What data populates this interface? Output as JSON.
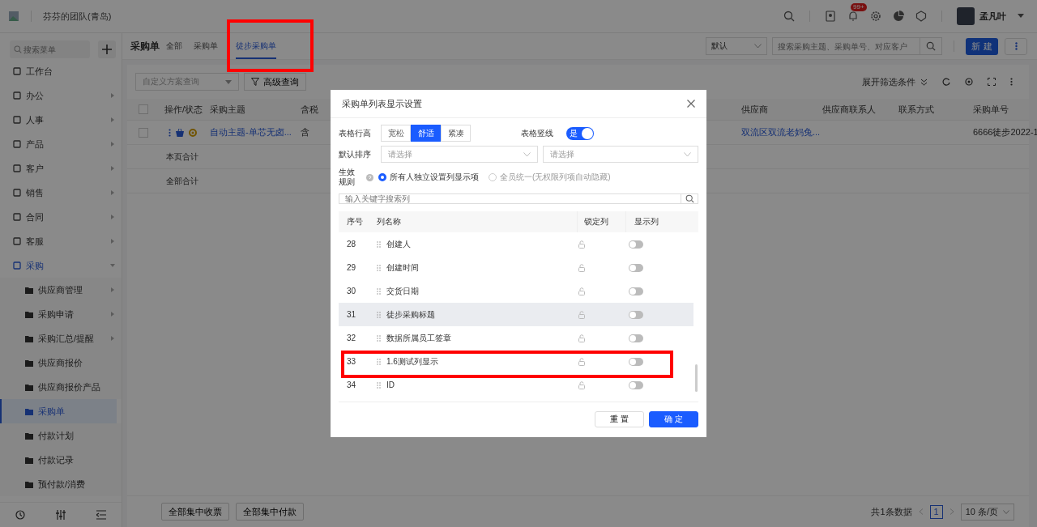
{
  "topbar": {
    "team": "芬芬的团队(青岛)",
    "badge": "99+",
    "user": "孟凡叶"
  },
  "sidebar": {
    "search_placeholder": "搜索菜单",
    "items": [
      {
        "label": "工作台",
        "expandable": false,
        "selected": false
      },
      {
        "label": "办公",
        "expandable": true,
        "expanded": false,
        "selected": false
      },
      {
        "label": "人事",
        "expandable": true,
        "expanded": false,
        "selected": false
      },
      {
        "label": "产品",
        "expandable": true,
        "expanded": false,
        "selected": false
      },
      {
        "label": "客户",
        "expandable": true,
        "expanded": false,
        "selected": false
      },
      {
        "label": "销售",
        "expandable": true,
        "expanded": false,
        "selected": false
      },
      {
        "label": "合同",
        "expandable": true,
        "expanded": false,
        "selected": false
      },
      {
        "label": "客服",
        "expandable": true,
        "expanded": false,
        "selected": false
      },
      {
        "label": "采购",
        "expandable": true,
        "expanded": true,
        "selected": true,
        "children": [
          {
            "label": "供应商管理",
            "expandable": true,
            "selected": false
          },
          {
            "label": "采购申请",
            "expandable": true,
            "selected": false
          },
          {
            "label": "采购汇总/提醒",
            "expandable": true,
            "selected": false
          },
          {
            "label": "供应商报价",
            "expandable": false,
            "selected": false
          },
          {
            "label": "供应商报价产品",
            "expandable": false,
            "selected": false
          },
          {
            "label": "采购单",
            "expandable": false,
            "selected": true
          },
          {
            "label": "付款计划",
            "expandable": false,
            "selected": false
          },
          {
            "label": "付款记录",
            "expandable": false,
            "selected": false
          },
          {
            "label": "预付款/消费",
            "expandable": false,
            "selected": false
          }
        ]
      }
    ]
  },
  "header": {
    "title": "采购单",
    "tabs": [
      {
        "label": "全部",
        "selected": false
      },
      {
        "label": "采购单",
        "selected": false
      },
      {
        "label": "徒步采购单",
        "selected": true
      }
    ],
    "filter": "默认",
    "search_placeholder": "搜索采购主题、采购单号、对应客户",
    "new_button": "新 建"
  },
  "toolbar": {
    "scheme_placeholder": "自定义方案查询",
    "advanced_button": "高级查询",
    "expand_filters": "展开筛选条件"
  },
  "table": {
    "all_checked": false,
    "columns": [
      "操作/状态",
      "采购主题",
      "含税",
      "",
      "供应商",
      "供应商联系人",
      "联系方式",
      "采购单号"
    ],
    "rows": [
      {
        "checked": false,
        "subject": "自动主题-单芯无卤...",
        "tax": "含",
        "supplier": "双流区双流老妈兔...",
        "number": "6666徒步2022-1"
      }
    ],
    "summary": [
      "本页合计",
      "全部合计"
    ]
  },
  "footer": {
    "buttons": [
      "全部集中收票",
      "全部集中付款"
    ],
    "total": "共1条数据",
    "page": "1",
    "page_size": "10 条/页"
  },
  "dialog": {
    "title": "采购单列表显示设置",
    "row_height_label": "表格行高",
    "row_heights": [
      {
        "label": "宽松",
        "selected": false
      },
      {
        "label": "舒适",
        "selected": true
      },
      {
        "label": "紧凑",
        "selected": false
      }
    ],
    "grid_label": "表格竖线",
    "grid_on": true,
    "grid_on_text": "是",
    "sort_label": "默认排序",
    "sort_placeholders": [
      "请选择",
      "请选择"
    ],
    "rule_label": "生效规则",
    "rules": [
      {
        "label": "所有人独立设置列显示项",
        "selected": true,
        "disabled": false
      },
      {
        "label": "全员统一(无权限列项自动隐藏)",
        "selected": false,
        "disabled": true
      }
    ],
    "search_placeholder": "输入关键字搜索列",
    "columns": [
      "序号",
      "列名称",
      "锁定列",
      "显示列"
    ],
    "rows": [
      {
        "no": "28",
        "name": "创建人",
        "locked": false,
        "shown": false,
        "hovered": false
      },
      {
        "no": "29",
        "name": "创建时间",
        "locked": false,
        "shown": false,
        "hovered": false
      },
      {
        "no": "30",
        "name": "交货日期",
        "locked": false,
        "shown": false,
        "hovered": false
      },
      {
        "no": "31",
        "name": "徒步采购标题",
        "locked": false,
        "shown": false,
        "hovered": true
      },
      {
        "no": "32",
        "name": "数据所属员工签章",
        "locked": false,
        "shown": false,
        "hovered": false
      },
      {
        "no": "33",
        "name": "1.6测试列显示",
        "locked": false,
        "shown": false,
        "hovered": false
      },
      {
        "no": "34",
        "name": "ID",
        "locked": false,
        "shown": false,
        "hovered": false
      }
    ],
    "buttons": [
      "重 置",
      "确 定"
    ]
  }
}
